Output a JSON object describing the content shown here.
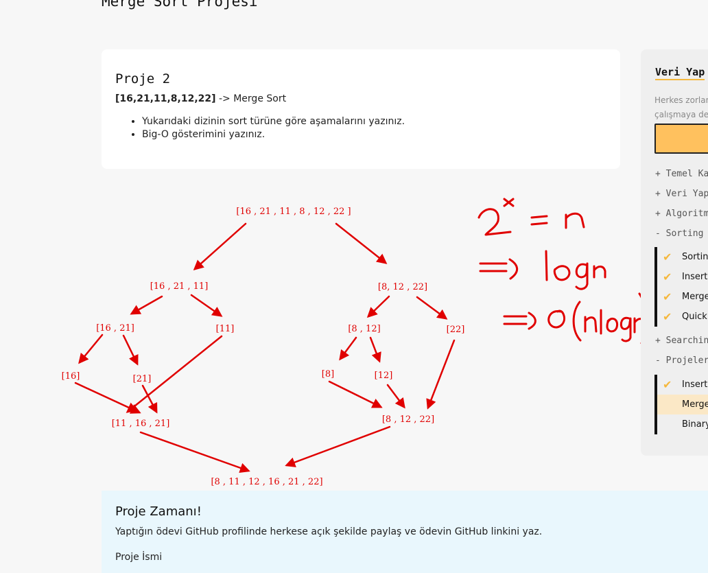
{
  "page": {
    "title": "Merge Sort Projesi"
  },
  "project": {
    "heading": "Proje 2",
    "array_text": "[16,21,11,8,12,22]",
    "arrow_text": " -> Merge Sort",
    "bullets": [
      "Yukarıdaki dizinin sort türüne göre aşamalarını yazınız.",
      "Big-O gösterimini yazınız."
    ]
  },
  "diagram": {
    "root": "[16 , 21 , 11 , 8 , 12 , 22 ]",
    "left_half": "[16 , 21 , 11]",
    "right_half": "[8, 12 , 22]",
    "l_pair": "[16 , 21]",
    "l_single": "[11]",
    "r_pair": "[8 , 12]",
    "r_single": "[22]",
    "leaf_16": "[16]",
    "leaf_21": "[21]",
    "leaf_8": "[8]",
    "leaf_12": "[12]",
    "merged_left": "[11 , 16 , 21]",
    "merged_right": "[8 , 12 , 22]",
    "result": "[8 , 11 , 12 , 16 , 21 , 22]",
    "color": "#e00000"
  },
  "sidebar": {
    "title": "Veri Yap",
    "desc_line1": "Herkes zorlan",
    "desc_line2": "çalışmaya dev",
    "sections": [
      "+ Temel Ka",
      "+ Veri Yap",
      "+ Algoritm",
      "- Sorting",
      "+ Searchin",
      "- Projeler"
    ],
    "sorting_items": [
      "Sorting",
      "Insertio",
      "Merge",
      "Quick S"
    ],
    "project_items": [
      "Insertio",
      "Merge",
      "Binary"
    ],
    "accent": "#f5b83d"
  },
  "time_card": {
    "heading": "Proje Zamanı!",
    "body": "Yaptığın ödevi GitHub profilinde herkese açık şekilde paylaş ve ödevin GitHub linkini yaz.",
    "name_label": "Proje İsmi"
  }
}
